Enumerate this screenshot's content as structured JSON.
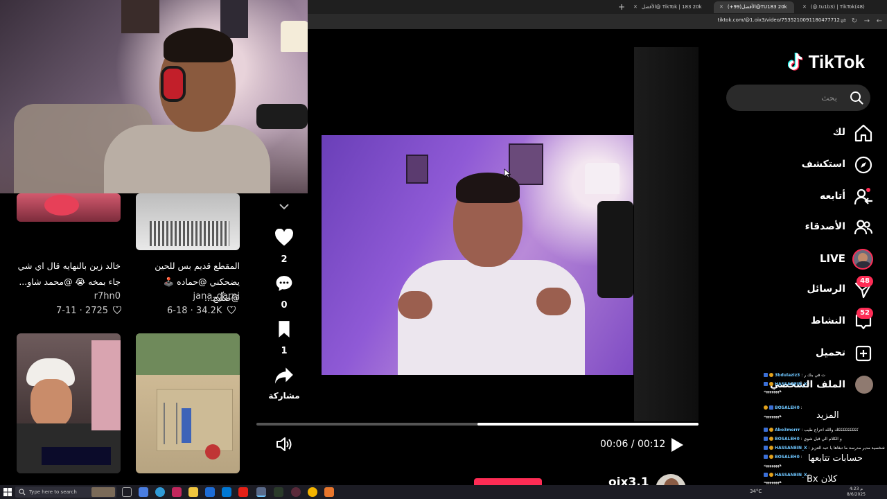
{
  "browser": {
    "tabs": [
      {
        "label": "‏(@.tu1b3) | TikTok(48)"
      },
      {
        "label": "(+99)الأفضل@TU183 20k",
        "active": true
      },
      {
        "label": "الأفضل@ TikTok | 183 20k"
      }
    ],
    "new_tab": "+",
    "url": "tiktok.com/@1.oix3/video/753521009118047771​2"
  },
  "grid": {
    "cards": [
      {
        "caption": "خالد زين بالنهايه قال اي شي جاء بمخه 😭 @محمد شاو...",
        "user": "r7hn0",
        "date": "7-11",
        "likes": "2725"
      },
      {
        "caption": "المقطع قديم بس للحين يضحكني @حماده 🕹️ @صلّيح...",
        "user": "jana_qarni",
        "date": "6-18",
        "likes": "34.2K"
      }
    ]
  },
  "actions": {
    "likes": "2",
    "comments": "0",
    "saves": "1",
    "share_label": "مشاركة"
  },
  "player": {
    "current_time": "00:06",
    "total_time": "00:12",
    "progress": 0.5,
    "creator": "oix3.1"
  },
  "nav": {
    "logo": "TikTok",
    "search_placeholder": "بحث",
    "items": [
      {
        "label": "لك"
      },
      {
        "label": "استكشف"
      },
      {
        "label": "أتابعه"
      },
      {
        "label": "الأصدقاء"
      },
      {
        "label": "LIVE"
      },
      {
        "label": "الرسائل",
        "badge": "48"
      },
      {
        "label": "النشاط",
        "badge": "52"
      },
      {
        "label": "تحميل"
      },
      {
        "label": "الملف الشخصي"
      }
    ],
    "ghost_labels": [
      "المزيد",
      "حسابات تتابعها",
      "كلان Bx"
    ]
  },
  "chat": [
    {
      "user": "3bdulaziz3",
      "msg": "ت في بنك ر"
    },
    {
      "user": "HASSANEIN_X",
      "msg": ""
    },
    {
      "user": "",
      "msg": "ههههههههه"
    },
    {
      "user": "BOSALEH0",
      "msg": ""
    },
    {
      "user": "",
      "msg": "ههههههههه"
    },
    {
      "user": "Abo3merrr",
      "msg": "كككككككككك والله احراج طيب"
    },
    {
      "user": "BOSALEH0",
      "msg": "و الكلام الي قبل شوي"
    },
    {
      "user": "HASSANEIN_X",
      "msg": "شخصية مدير مدرسة ما تبغاها يا عبد العزيز"
    },
    {
      "user": "BOSALEH0",
      "msg": ""
    },
    {
      "user": "",
      "msg": "ههههههههه"
    },
    {
      "user": "HASSANEIN_X",
      "msg": ""
    },
    {
      "user": "",
      "msg": "ههههههههه"
    }
  ],
  "taskbar": {
    "search_placeholder": "Type here to search",
    "weather": "34°C",
    "time": "4:23 م",
    "date": "8/6/2025"
  },
  "colors": {
    "accent": "#fe2c55",
    "cyan": "#25f4ee",
    "bg": "#000000"
  }
}
